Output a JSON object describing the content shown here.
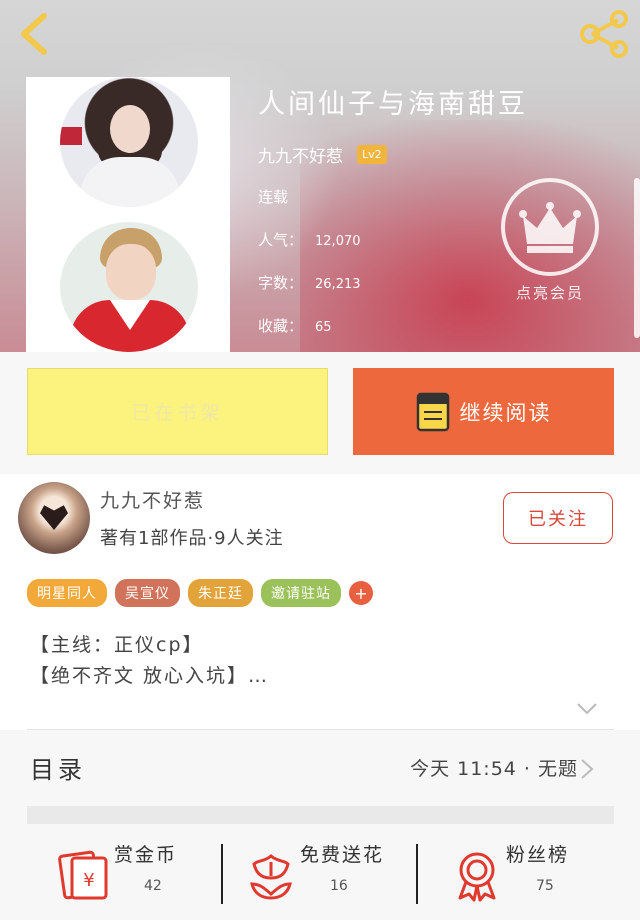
{
  "header": {
    "back_icon": "chevron-left-icon",
    "share_icon": "share-icon"
  },
  "book": {
    "title": "人间仙子与海南甜豆",
    "author": "九九不好惹",
    "author_level": "Lv2",
    "status": "连载",
    "popularity_label": "人气：",
    "popularity": "12,070",
    "words_label": "字数：",
    "words": "26,213",
    "favorites_label": "收藏：",
    "favorites": "65"
  },
  "vip": {
    "label": "点亮会员",
    "icon": "crown-icon"
  },
  "actions": {
    "shelf_label": "已在书架",
    "read_label": "继续阅读",
    "read_icon": "book-icon"
  },
  "author_card": {
    "name": "九九不好惹",
    "stats": "著有1部作品·9人关注",
    "follow_label": "已关注"
  },
  "tags": [
    {
      "label": "明星同人",
      "color": "#f3a93a"
    },
    {
      "label": "吴宣仪",
      "color": "#d0735a"
    },
    {
      "label": "朱正廷",
      "color": "#e2a43a"
    },
    {
      "label": "邀请驻站",
      "color": "#9bc15b"
    }
  ],
  "tag_add": "+",
  "summary": {
    "line1": "【主线：正仪cp】",
    "line2": "【绝不齐文 放心入坑】…"
  },
  "catalog": {
    "title": "目录",
    "latest": "今天 11:54 · 无题"
  },
  "bottom_stats": [
    {
      "name": "赏金币",
      "count": "42",
      "icon": "red-envelope-icon"
    },
    {
      "name": "免费送花",
      "count": "16",
      "icon": "flower-icon"
    },
    {
      "name": "粉丝榜",
      "count": "75",
      "icon": "medal-icon"
    }
  ],
  "colors": {
    "accent": "#ed683d",
    "shelf_bg": "#fbf37d",
    "follow": "#d8493a",
    "icon_red": "#e0392e"
  }
}
